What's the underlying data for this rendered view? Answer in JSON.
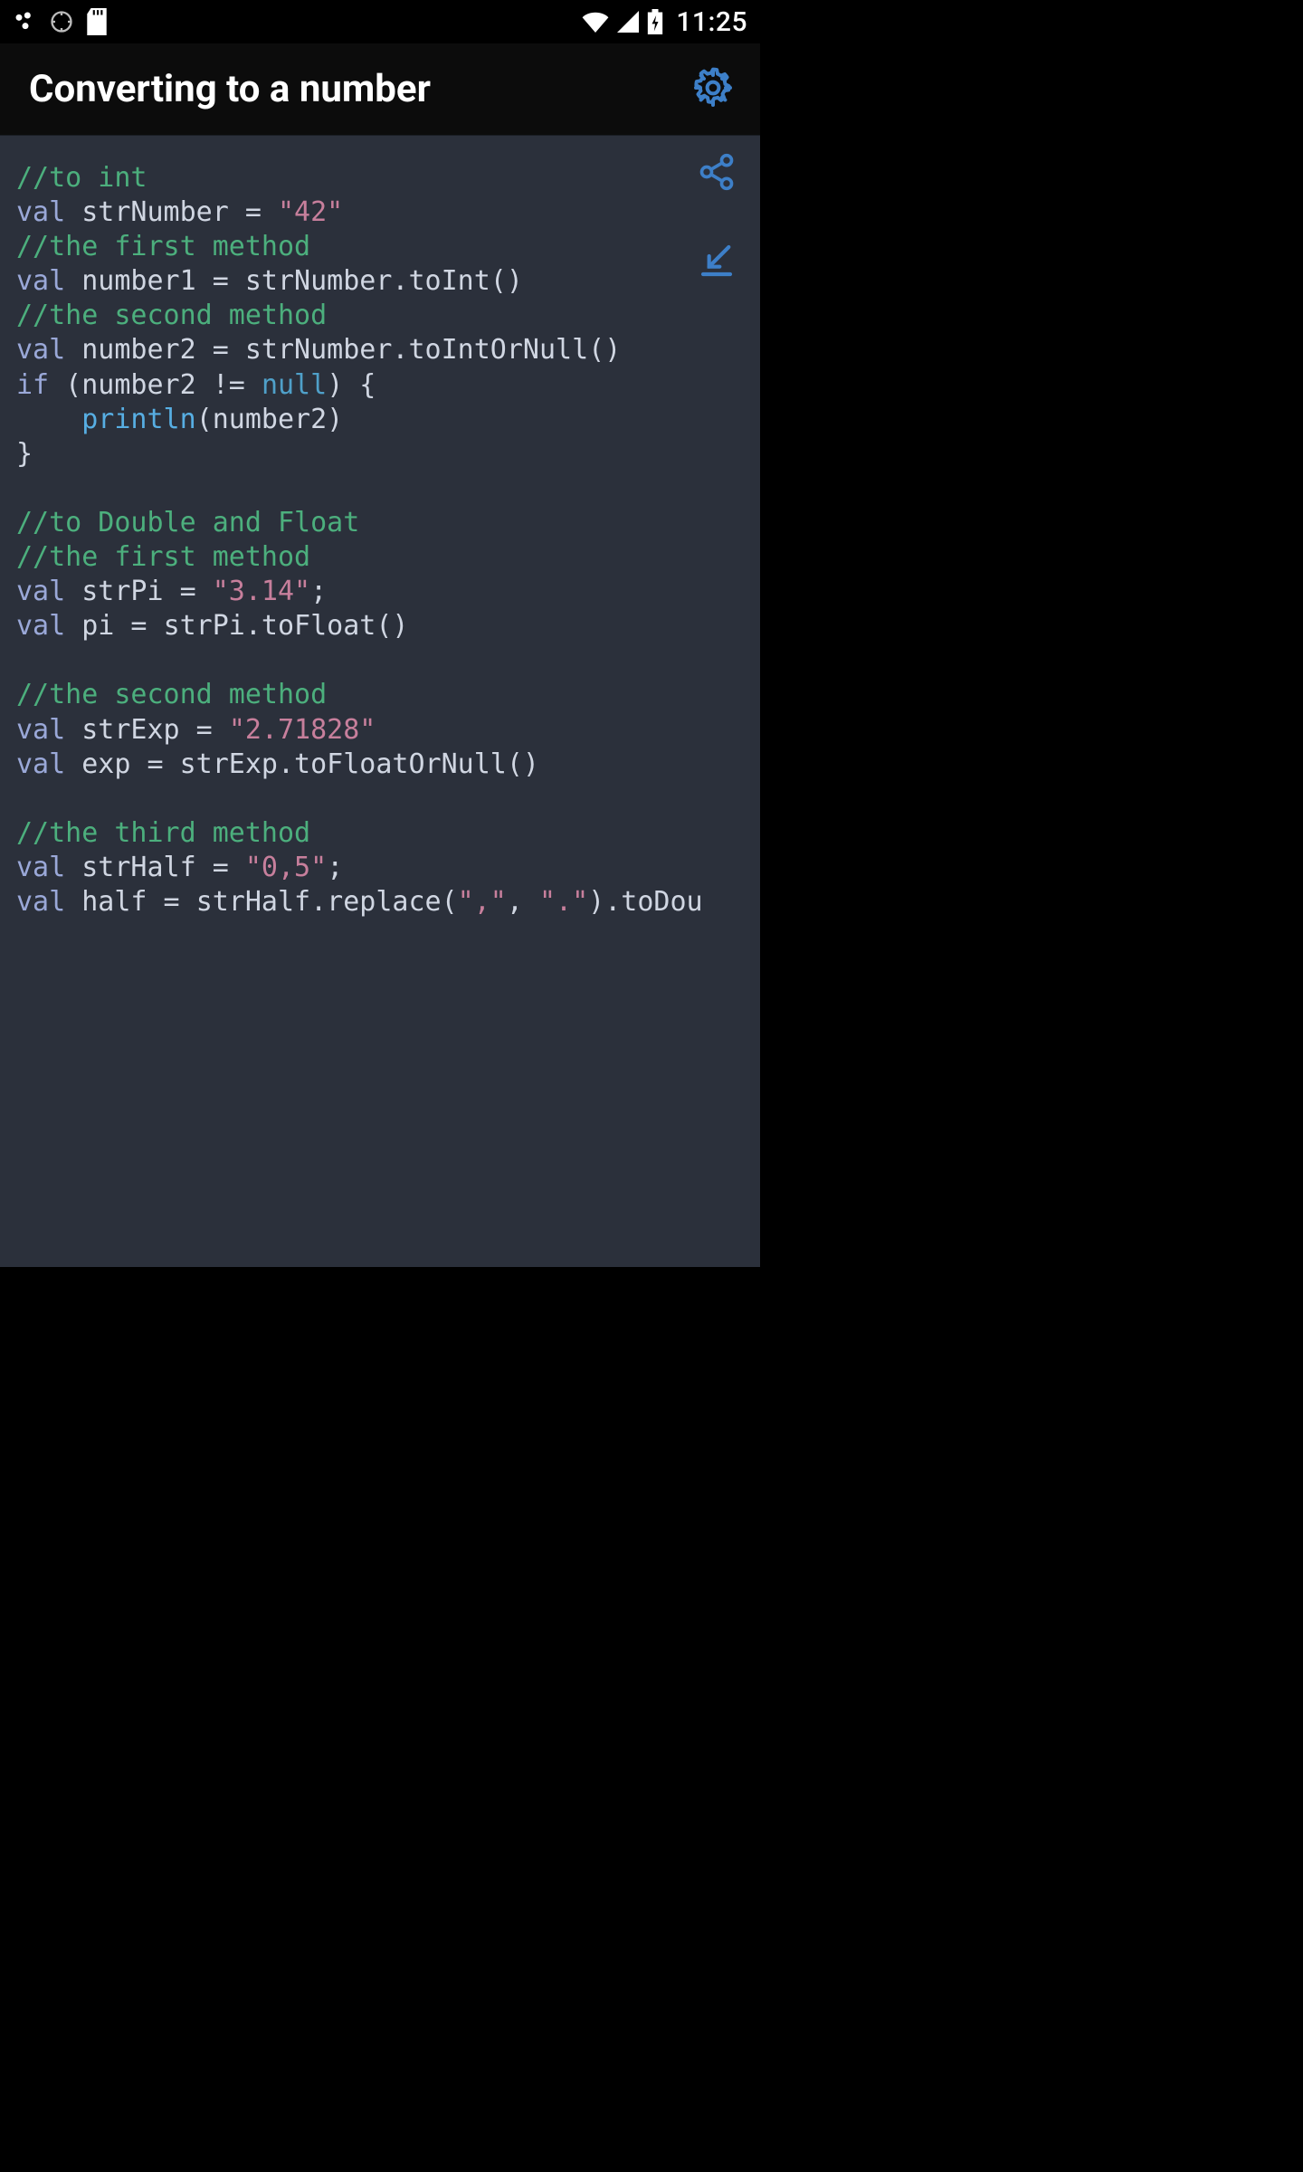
{
  "status": {
    "clock": "11:25"
  },
  "appbar": {
    "title": "Converting to a number"
  },
  "code": {
    "comment_to_int": "//to int",
    "val": "val",
    "if": "if",
    "strNumber_decl": "strNumber",
    "eq": " = ",
    "strNumber_val": "\"42\"",
    "comment_first_method": "//the first method",
    "number1_decl": "number1",
    "strNumber_toInt": "strNumber.toInt()",
    "comment_second_method": "//the second method",
    "number2_decl": "number2",
    "strNumber_toIntOrNull": "strNumber.toIntOrNull()",
    "if_open": " (number2 != ",
    "null_kw": "null",
    "if_close_brace": ") {",
    "indent": "    ",
    "println_fn": "println",
    "println_arg": "(number2)",
    "brace_close": "}",
    "blank": "",
    "comment_to_double_float": "//to Double and Float",
    "strPi_decl": "strPi",
    "strPi_val": "\"3.14\"",
    "semi": ";",
    "pi_decl": "pi",
    "strPi_toFloat": "strPi.toFloat()",
    "strExp_decl": "strExp",
    "strExp_val": "\"2.71828\"",
    "exp_decl": "exp",
    "strExp_toFloatOrNull": "strExp.toFloatOrNull()",
    "comment_third_method": "//the third method",
    "strHalf_decl": "strHalf",
    "strHalf_val": "\"0,5\"",
    "half_decl": "half",
    "strHalf_replace_pre": "strHalf.replace(",
    "strHalf_replace_arg1": "\",\"",
    "comma_sep": ", ",
    "strHalf_replace_arg2": "\".\"",
    "strHalf_replace_post": ").toDou"
  },
  "colors": {
    "bg": "#2b303b",
    "comment": "#4caf7d",
    "keyword": "#9aa8d8",
    "string": "#c77f9c",
    "null": "#4fa0c9",
    "function": "#57aee3",
    "accent_icon": "#3d7fc8"
  }
}
